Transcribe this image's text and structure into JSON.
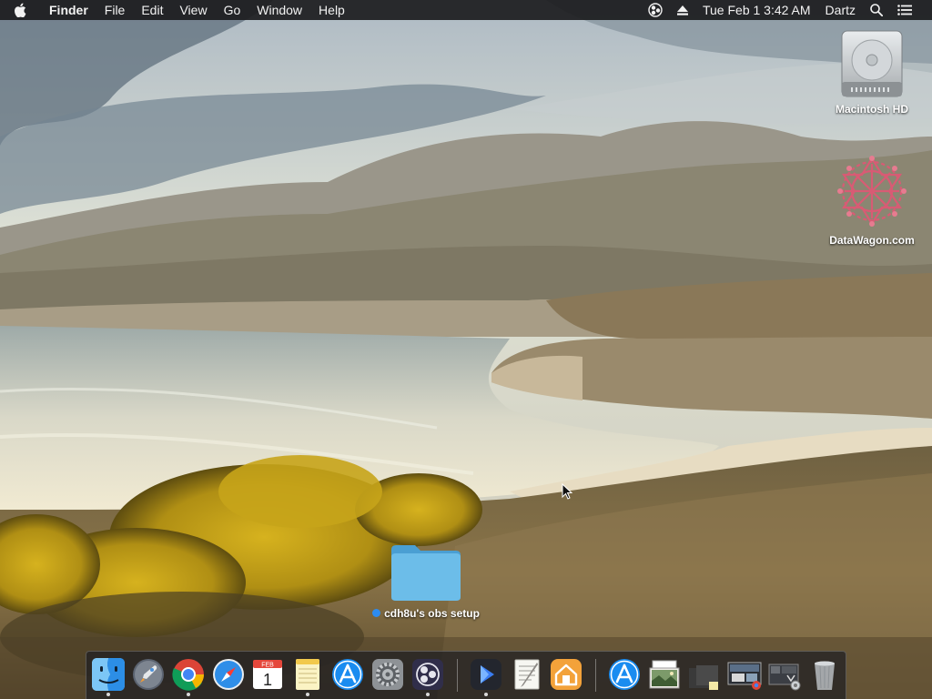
{
  "menubar": {
    "app_name": "Finder",
    "menus": [
      "File",
      "Edit",
      "View",
      "Go",
      "Window",
      "Help"
    ],
    "clock": "Tue Feb 1  3:42 AM",
    "user": "Dartz",
    "status_icons": [
      "obs-icon",
      "eject-icon",
      "spotlight-icon",
      "notification-center-icon"
    ]
  },
  "desktop": {
    "icons": [
      {
        "label": "Macintosh HD",
        "icon": "hard-drive-icon"
      },
      {
        "label": "DataWagon.com",
        "icon": "datawagon-logo-icon"
      },
      {
        "label": "cdh8u's obs setup",
        "icon": "folder-icon",
        "tag_color": "#2d8cf0"
      }
    ]
  },
  "dock": {
    "apps": [
      {
        "name": "Finder",
        "icon": "finder-icon",
        "running": true
      },
      {
        "name": "Launchpad",
        "icon": "launchpad-icon",
        "running": false
      },
      {
        "name": "Google Chrome",
        "icon": "chrome-icon",
        "running": true
      },
      {
        "name": "Safari",
        "icon": "safari-icon",
        "running": false
      },
      {
        "name": "Calendar",
        "icon": "calendar-icon",
        "running": false,
        "month": "FEB",
        "day": "1"
      },
      {
        "name": "Notes",
        "icon": "notes-icon",
        "running": true
      },
      {
        "name": "App Store",
        "icon": "app-store-icon",
        "running": false
      },
      {
        "name": "System Preferences",
        "icon": "system-preferences-icon",
        "running": false
      },
      {
        "name": "OBS",
        "icon": "obs-icon",
        "running": true
      },
      {
        "name": "Infuse",
        "icon": "infuse-icon",
        "running": true
      },
      {
        "name": "TextEdit",
        "icon": "textedit-icon",
        "running": false
      },
      {
        "name": "Home",
        "icon": "home-icon",
        "running": false
      },
      {
        "name": "Applications",
        "icon": "applications-folder-icon",
        "running": false
      },
      {
        "name": "Preview",
        "icon": "preview-icon",
        "running": false
      },
      {
        "name": "Documents stack",
        "icon": "documents-stack-icon",
        "running": false
      },
      {
        "name": "Screenshots stack",
        "icon": "screenshots-stack-icon",
        "running": false
      },
      {
        "name": "Downloads stack",
        "icon": "downloads-stack-icon",
        "running": false
      },
      {
        "name": "Trash",
        "icon": "trash-icon",
        "running": false
      }
    ]
  },
  "colors": {
    "menubar_bg": "#1c1c1e",
    "folder_blue": "#5eb5e6",
    "tag_blue": "#2d8cf0"
  }
}
